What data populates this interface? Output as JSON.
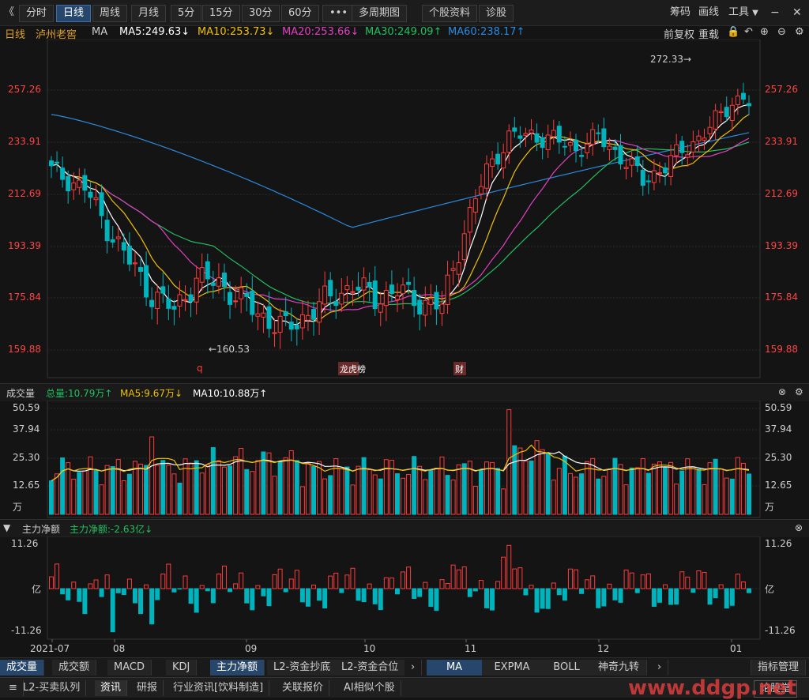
{
  "toolbar": {
    "back_label": "《",
    "periods": [
      "分时",
      "日线",
      "周线",
      "月线",
      "5分",
      "15分",
      "30分",
      "60分",
      "•••",
      "多周期图",
      "个股资料",
      "诊股"
    ],
    "active_period": "日线",
    "right_items": [
      "筹码",
      "画线",
      "工具"
    ],
    "window_controls": [
      "minimize-icon",
      "close-icon"
    ]
  },
  "ma_bar": {
    "period": "日线",
    "stock_name": "泸州老窖",
    "indicator": "MA",
    "ma5": "MA5:249.63↓",
    "ma10": "MA10:253.73↓",
    "ma20": "MA20:253.66↓",
    "ma30": "MA30:249.09↑",
    "ma60": "MA60:238.17↑",
    "right_items": [
      "前复权",
      "重载"
    ]
  },
  "colors": {
    "up": "#ff3b3b",
    "down": "#00b4be",
    "ma5": "#ffffff",
    "ma10": "#f0c000",
    "ma20": "#e040c0",
    "ma30": "#20c060",
    "ma60": "#2a8ae0",
    "accent": "#27466b"
  },
  "price_axis": [
    "257.26",
    "233.91",
    "212.69",
    "193.39",
    "175.84",
    "159.88"
  ],
  "annotations": {
    "high": "272.33→",
    "low": "←160.53",
    "event_q": "q",
    "event_bang": "龙虎榜",
    "event_cai": "财"
  },
  "volume_panel": {
    "title": "成交量",
    "total": "总量:10.79万↑",
    "ma5": "MA5:9.67万↓",
    "ma10": "MA10:10.88万↑",
    "axis": [
      "50.59",
      "37.94",
      "25.30",
      "12.65",
      "万"
    ]
  },
  "flow_panel": {
    "title": "主力净额",
    "value": "主力净额:-2.63亿↓",
    "axis": [
      "11.26",
      "亿",
      "-11.26"
    ]
  },
  "date_axis": [
    "2021-07",
    "08",
    "09",
    "10",
    "11",
    "12",
    "01"
  ],
  "indicator_tabs": [
    "成交量",
    "成交额",
    "MACD",
    "KDJ",
    "主力净额",
    "L2-资金抄底",
    "L2-资金合位"
  ],
  "indicator_tabs_active": [
    "成交量",
    "主力净额"
  ],
  "overlay_tabs": [
    "MA",
    "EXPMA",
    "BOLL",
    "神奇九转"
  ],
  "overlay_active": "MA",
  "indicator_manage": "指标管理",
  "bottom_tabs": [
    "L2-买卖队列",
    "资讯",
    "研报",
    "行业资讯[饮料制造]",
    "关联报价",
    "AI相似个股"
  ],
  "bottom_active": "资讯",
  "forum": "论股堂",
  "watermark": "www.ddgp.net"
}
